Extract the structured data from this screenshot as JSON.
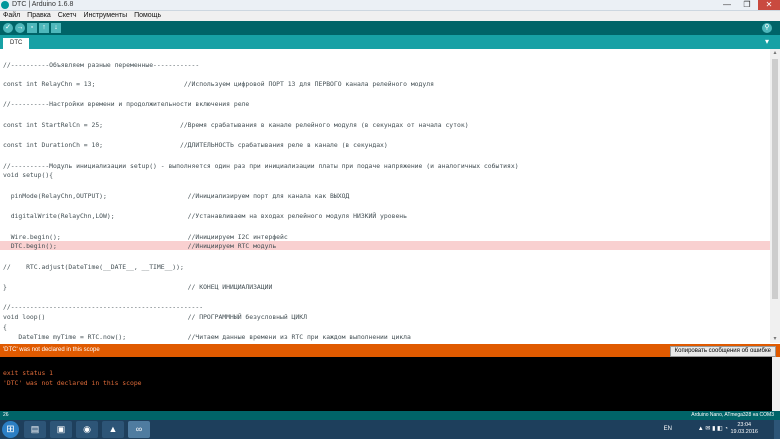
{
  "window": {
    "title": "DTC | Arduino 1.6.8",
    "controls": [
      "—",
      "❐",
      "✕"
    ]
  },
  "menu": [
    "Файл",
    "Правка",
    "Скетч",
    "Инструменты",
    "Помощь"
  ],
  "toolbar": {
    "buttons": [
      "verify-icon",
      "upload-icon",
      "new-icon",
      "open-icon",
      "save-icon"
    ],
    "glyphs": [
      "✓",
      "→",
      "▫",
      "↑",
      "↓"
    ],
    "serial_glyph": "⚲"
  },
  "tab": {
    "label": "DTC",
    "menu_glyph": "▾"
  },
  "code": [
    {
      "text": "//----------Объявляем разные переменные------------"
    },
    {
      "text": "const int RelayChn = 13;                       //Используем цифровой ПОРТ 13 для ПЕРВОГО канала релейного модуля"
    },
    {
      "text": "//----------Настройки времени и продолжительности включения реле"
    },
    {
      "text": "const int StartRelCn = 25;                    //Время срабатывания в канале релейного модуля (в секундах от начала суток)"
    },
    {
      "text": "const int DurationCh = 10;                    //ДЛИТЕЛЬНОСТЬ срабатывания реле в канале (в секундах)"
    },
    {
      "text": "//----------Модуль инициализации setup() - выполняется один раз при инициализации платы при подаче напряжение (и аналогичных событиях)"
    },
    {
      "text": "void setup(){"
    },
    {
      "text": "  pinMode(RelayChn,OUTPUT);                     //Инициализируем порт для канала как ВЫХОД"
    },
    {
      "text": "  digitalWrite(RelayChn,LOW);                   //Устанавливаем на входах релейного модуля НИЗКИЙ уровень"
    },
    {
      "text": "  Wire.begin();                                 //Инициируем I2C интерфейс"
    },
    {
      "text": "  DTC.begin();                                  //Инициируем RTC модуль"
    },
    {
      "text": "//    RTC.adjust(DateTime(__DATE__, __TIME__));"
    },
    {
      "text": "}                                               // КОНЕЦ ИНИЦИАЛИЗАЦИИ"
    },
    {
      "text": "//--------------------------------------------------"
    },
    {
      "text": "void loop()                                     // ПРОГРАММНЫЙ безусловный ЦИКЛ"
    },
    {
      "text": "{"
    },
    {
      "text": "    DateTime myTime = RTC.now();                //Читаем данные времени из RTC при каждом выполнении цикла"
    }
  ],
  "error": {
    "message": "'DTC' was not declared in this scope",
    "copy_button": "Копировать сообщения об ошибке"
  },
  "console": [
    "exit status 1",
    "'DTC' was not declared in this scope"
  ],
  "status": {
    "line": "26",
    "board": "Arduino Nano, ATmega328 на COM3"
  },
  "taskbar": {
    "start_glyph": "⊞",
    "apps": [
      {
        "name": "file-explorer-icon",
        "glyph": "▤"
      },
      {
        "name": "folder-icon",
        "glyph": "▣"
      },
      {
        "name": "firefox-icon",
        "glyph": "◉"
      },
      {
        "name": "drive-icon",
        "glyph": "▲"
      },
      {
        "name": "arduino-icon",
        "glyph": "∞"
      }
    ],
    "lang": "EN",
    "tray_icons": "▲ ✉ ▮ ◧ ◔",
    "time": "23:04",
    "date": "19.03.2016"
  },
  "colors": {
    "toolbar": "#006468",
    "tabbar": "#17a1a5",
    "error_bar": "#e05a00",
    "console_text": "#e06c3a",
    "highlight": "#f9d0d0"
  }
}
